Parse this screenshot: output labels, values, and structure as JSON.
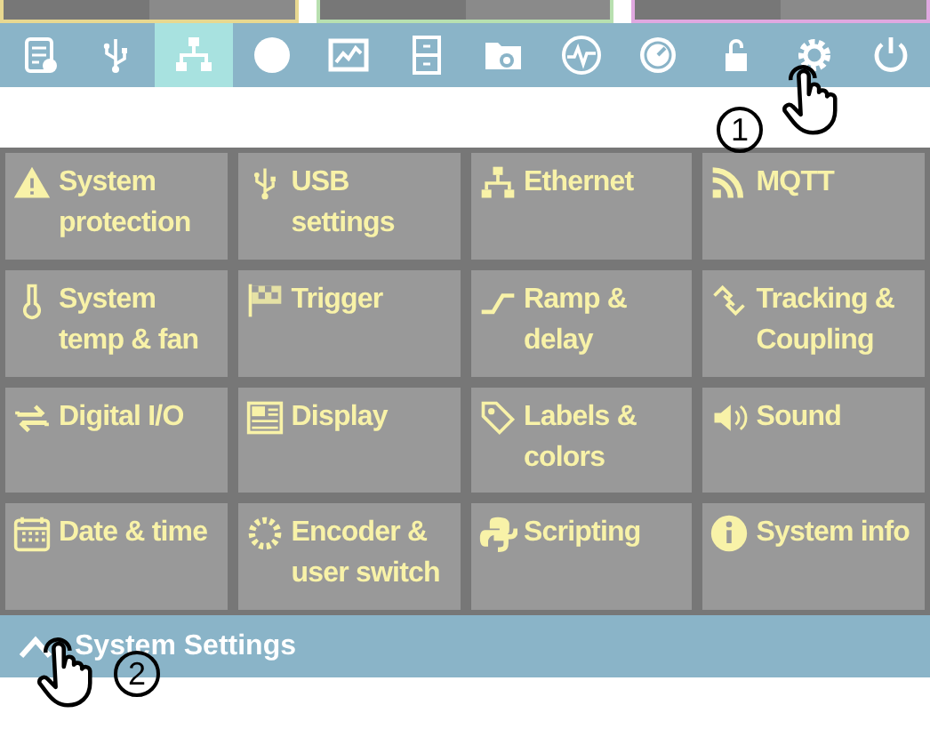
{
  "channel_strip": [
    {
      "color": "#e8d890"
    },
    {
      "color": "#b8e0b0"
    },
    {
      "color": "#e0a8e0"
    }
  ],
  "toolbar": [
    {
      "kind": "log",
      "selected": false
    },
    {
      "kind": "usb",
      "selected": false
    },
    {
      "kind": "network",
      "selected": true
    },
    {
      "kind": "circle",
      "selected": false
    },
    {
      "kind": "chart",
      "selected": false
    },
    {
      "kind": "drawers",
      "selected": false
    },
    {
      "kind": "folder",
      "selected": false
    },
    {
      "kind": "wave",
      "selected": false
    },
    {
      "kind": "gauge",
      "selected": false
    },
    {
      "kind": "lock",
      "selected": false
    },
    {
      "kind": "gear",
      "selected": false
    },
    {
      "kind": "power",
      "selected": false
    }
  ],
  "menu": [
    {
      "kind": "warning",
      "label": "System protection"
    },
    {
      "kind": "usb",
      "label": "USB settings"
    },
    {
      "kind": "network",
      "label": "Ethernet"
    },
    {
      "kind": "signal",
      "label": "MQTT"
    },
    {
      "kind": "thermometer",
      "label": "System temp & fan"
    },
    {
      "kind": "flag",
      "label": "Trigger"
    },
    {
      "kind": "ramp",
      "label": "Ramp & delay"
    },
    {
      "kind": "link",
      "label": "Tracking & Coupling"
    },
    {
      "kind": "arrows",
      "label": "Digital I/O"
    },
    {
      "kind": "display",
      "label": "Display"
    },
    {
      "kind": "tag",
      "label": "Labels & colors"
    },
    {
      "kind": "speaker",
      "label": "Sound"
    },
    {
      "kind": "calendar",
      "label": "Date & time"
    },
    {
      "kind": "spinner",
      "label": "Encoder & user switch"
    },
    {
      "kind": "python",
      "label": "Scripting"
    },
    {
      "kind": "info",
      "label": "System info"
    }
  ],
  "footer": {
    "title": "System Settings"
  },
  "annotations": [
    {
      "number": "1"
    },
    {
      "number": "2"
    }
  ]
}
